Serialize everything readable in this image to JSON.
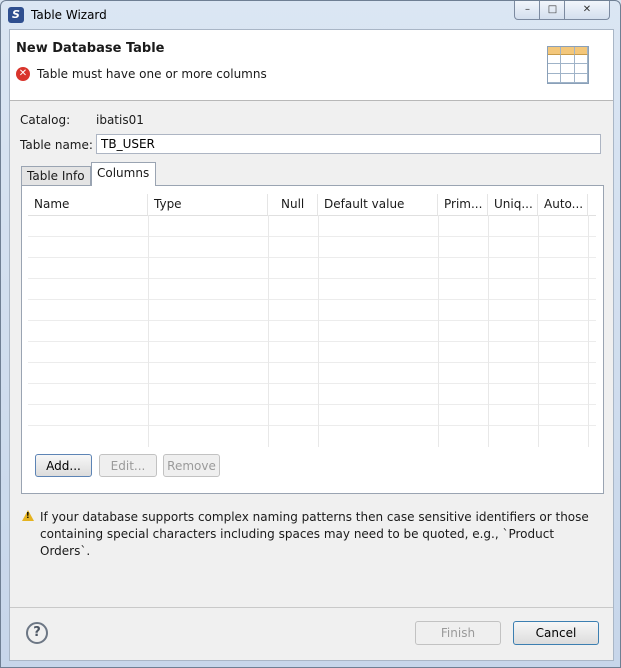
{
  "window": {
    "title": "Table Wizard",
    "minimize": "–",
    "maximize": "□",
    "close": "✕"
  },
  "header": {
    "title": "New Database Table",
    "message": "Table must have one or more columns",
    "error_icon": "error-icon",
    "banner_icon": "table-icon"
  },
  "form": {
    "catalog_label": "Catalog:",
    "catalog_value": "ibatis01",
    "table_name_label": "Table name:",
    "table_name_value": "TB_USER"
  },
  "tabs": [
    {
      "label": "Table Info",
      "selected": false
    },
    {
      "label": "Columns",
      "selected": true
    }
  ],
  "columns_table": {
    "headers": [
      "Name",
      "Type",
      "Null",
      "Default value",
      "Prim...",
      "Uniq...",
      "Auto..."
    ],
    "rows": []
  },
  "column_buttons": {
    "add": "Add...",
    "edit": "Edit...",
    "remove": "Remove"
  },
  "warning": {
    "icon": "warning-icon",
    "text": "If your database supports complex naming patterns then case sensitive identifiers or those containing special characters including spaces may need to be quoted, e.g., `Product Orders`."
  },
  "footer": {
    "help_icon": "help-icon",
    "help": "?",
    "finish": "Finish",
    "cancel": "Cancel"
  }
}
